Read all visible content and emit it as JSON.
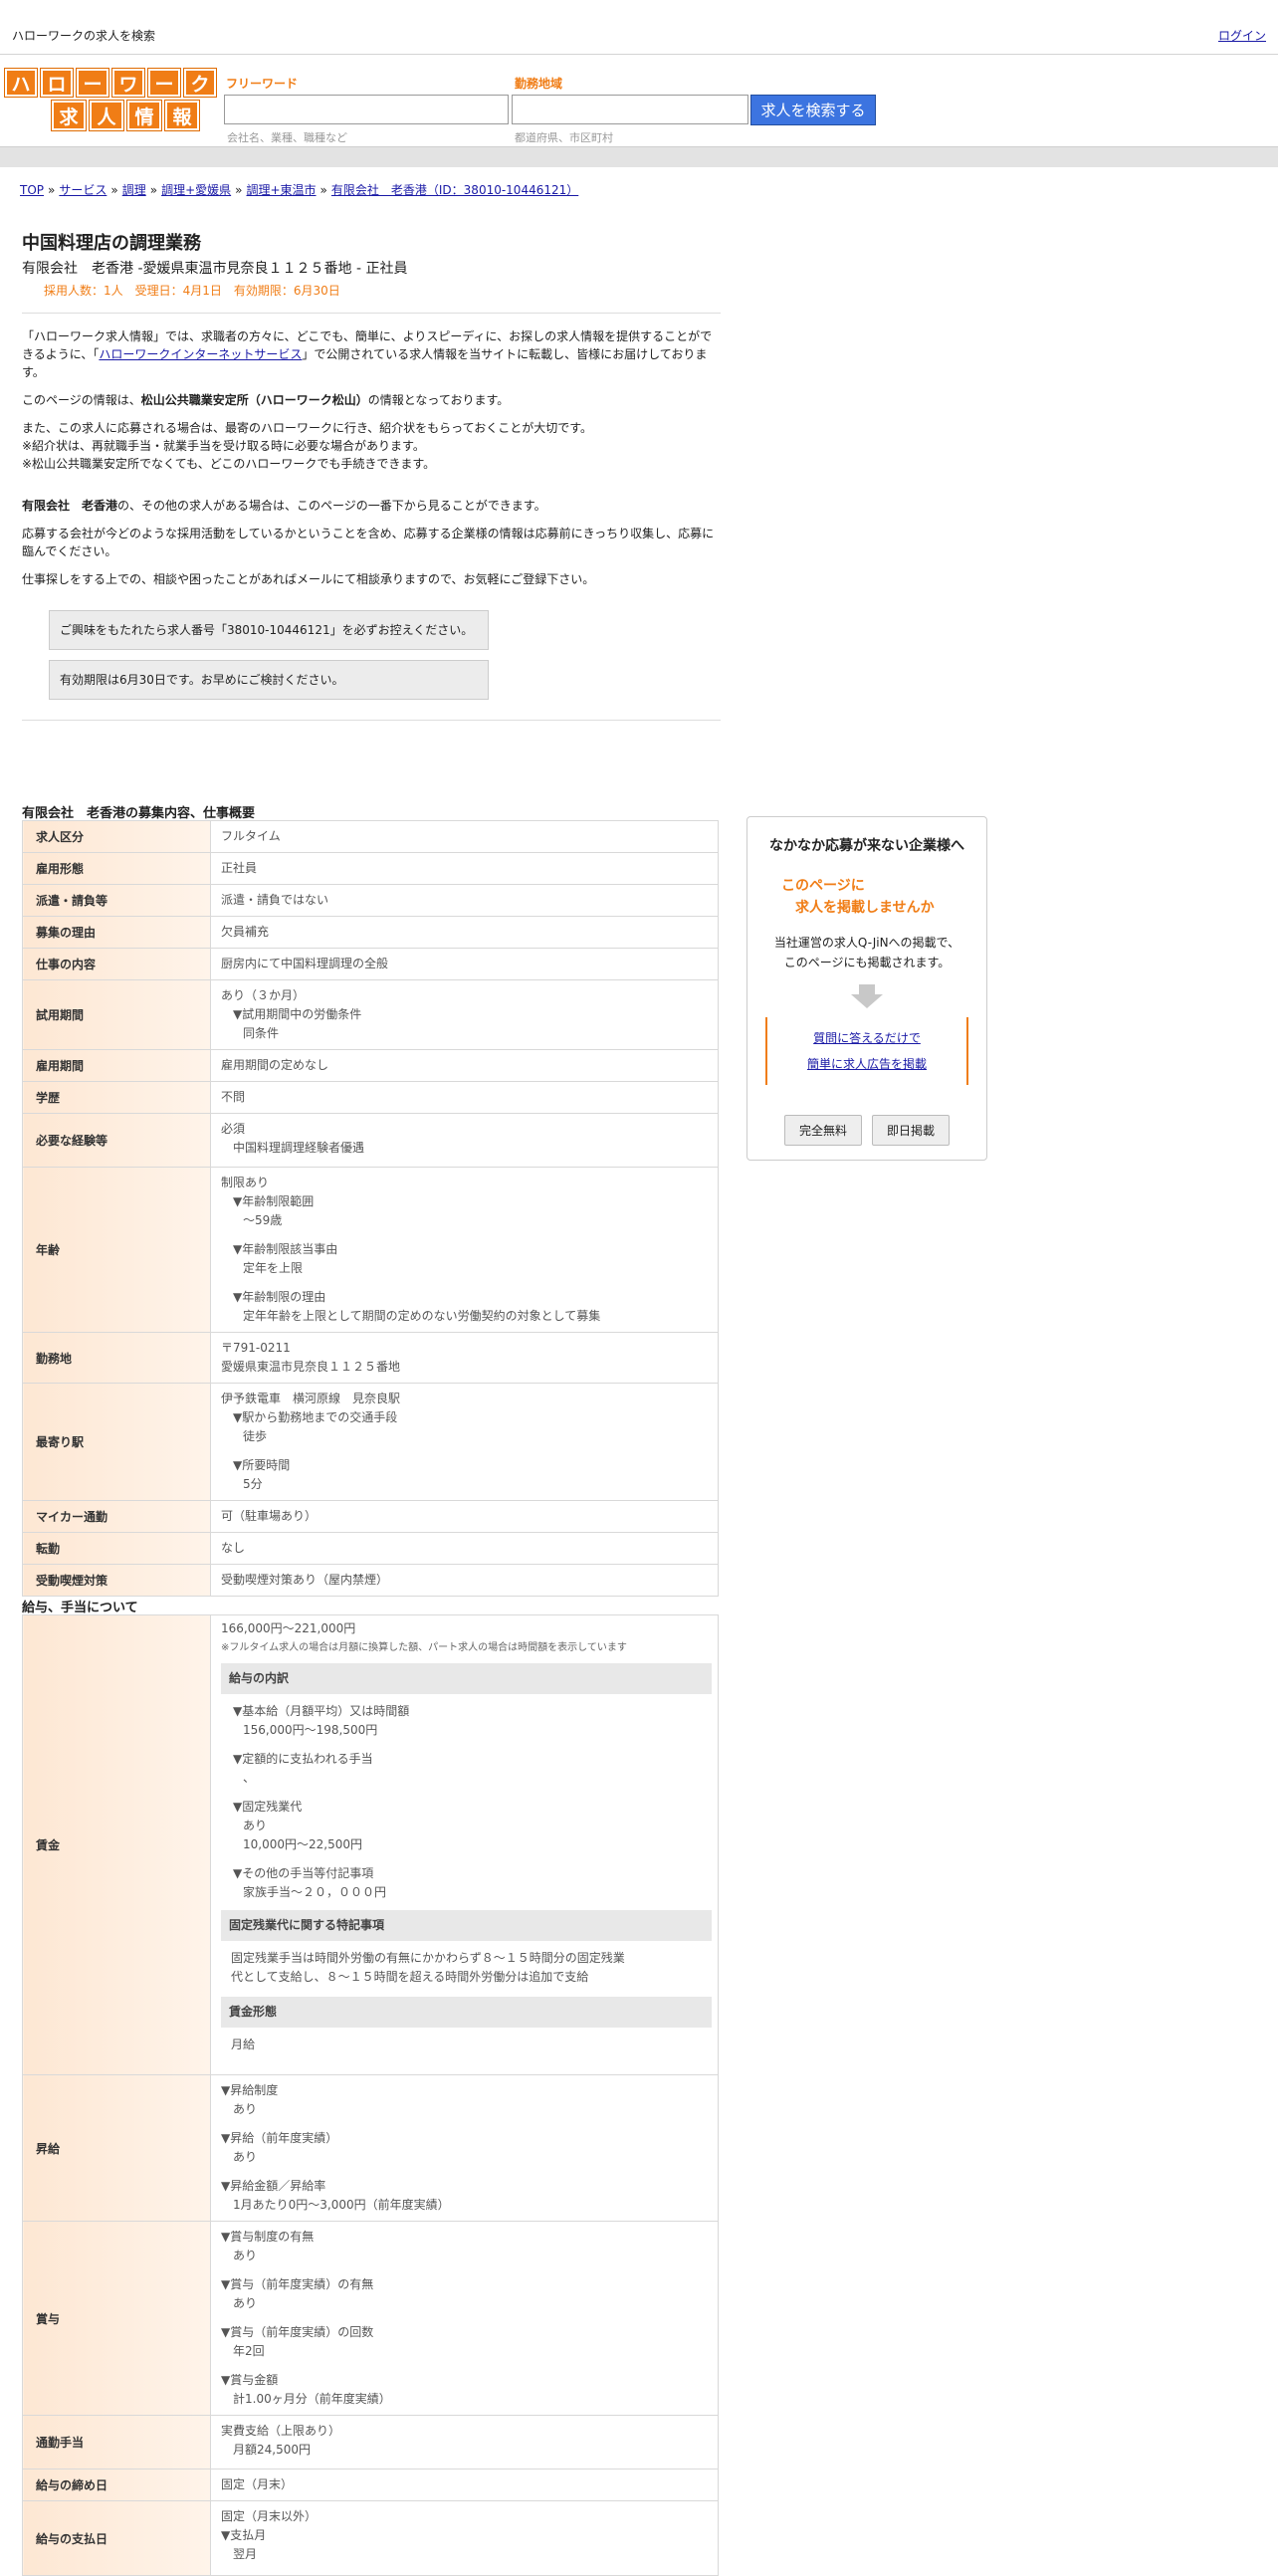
{
  "topbar": {
    "site_title": "ハローワークの求人を検索",
    "login": "ログイン"
  },
  "logo": {
    "row1": [
      "ハ",
      "ロ",
      "ー",
      "ワ",
      "ー",
      "ク"
    ],
    "row2": [
      "求",
      "人",
      "情",
      "報"
    ]
  },
  "search": {
    "keyword_label": "フリーワード",
    "keyword_placeholder": "会社名、業種、職種など",
    "area_label": "勤務地域",
    "area_placeholder": "都道府県、市区町村",
    "button": "求人を検索する"
  },
  "breadcrumb": [
    "TOP",
    "サービス",
    "調理",
    "調理+愛媛県",
    "調理+東温市",
    "有限会社　老香港（ID：38010-10446121）"
  ],
  "job": {
    "title": "中国料理店の調理業務",
    "subtitle": "有限会社　老香港 -愛媛県東温市見奈良１１２５番地 - 正社員",
    "meta": "採用人数：1人　受理日：4月1日　有効期限：6月30日"
  },
  "intro": {
    "p1_a": "「ハローワーク求人情報」では、求職者の方々に、どこでも、簡単に、よりスピーディに、お探しの求人情報を提供することができるように、「",
    "p1_link": "ハローワークインターネットサービス",
    "p1_b": "」で公開されている求人情報を当サイトに転載し、皆様にお届けしております。",
    "p2_a": "このページの情報は、",
    "p2_bold": "松山公共職業安定所（ハローワーク松山）",
    "p2_b": "の情報となっております。",
    "p3_1": "また、この求人に応募される場合は、最寄のハローワークに行き、紹介状をもらっておくことが大切です。",
    "p3_2": "※紹介状は、再就職手当・就業手当を受け取る時に必要な場合があります。",
    "p3_3": "※松山公共職業安定所でなくても、どこのハローワークでも手続きできます。",
    "p4_bold": "有限会社　老香港",
    "p4": "の、その他の求人がある場合は、このページの一番下から見ることができます。",
    "p5": "応募する会社が今どのような採用活動をしているかということを含め、応募する企業様の情報は応募前にきっちり収集し、応募に臨んでください。",
    "p6": "仕事探しをする上での、相談や困ったことがあればメールにて相談承りますので、お気軽にご登録下さい。"
  },
  "notes": {
    "n1": "ご興味をもたれたら求人番号「38010-10446121」を必ずお控えください。",
    "n2": "有効期限は6月30日です。お早めにご検討ください。"
  },
  "section1": {
    "heading": "有限会社　老香港の募集内容、仕事概要",
    "rows": {
      "kyujin_kubun": {
        "label": "求人区分",
        "value": "フルタイム"
      },
      "koyo_keitai": {
        "label": "雇用形態",
        "value": "正社員"
      },
      "haken": {
        "label": "派遣・請負等",
        "value": "派遣・請負ではない"
      },
      "riyu": {
        "label": "募集の理由",
        "value": "欠員補充"
      },
      "naiyo": {
        "label": "仕事の内容",
        "value": "厨房内にて中国料理調理の全般"
      },
      "shiyo": {
        "label": "試用期間",
        "l1": "あり（３か月）",
        "l2": "▼試用期間中の労働条件",
        "l3": "同条件"
      },
      "koyo_kikan": {
        "label": "雇用期間",
        "value": "雇用期間の定めなし"
      },
      "gakureki": {
        "label": "学歴",
        "value": "不問"
      },
      "keiken": {
        "label": "必要な経験等",
        "l1": "必須",
        "l2": "中国料理調理経験者優遇"
      },
      "nenrei": {
        "label": "年齢",
        "l1": "制限あり",
        "l2": "▼年齢制限範囲",
        "l3": "〜59歳",
        "l4": "▼年齢制限該当事由",
        "l5": "定年を上限",
        "l6": "▼年齢制限の理由",
        "l7": "定年年齢を上限として期間の定めのない労働契約の対象として募集"
      },
      "kinmuchi": {
        "label": "勤務地",
        "l1": "〒791-0211",
        "l2": "愛媛県東温市見奈良１１２５番地"
      },
      "eki": {
        "label": "最寄り駅",
        "l1": "伊予鉄電車　横河原線　見奈良駅",
        "l2": "▼駅から勤務地までの交通手段",
        "l3": "徒歩",
        "l4": "▼所要時間",
        "l5": "5分"
      },
      "mycar": {
        "label": "マイカー通勤",
        "value": "可（駐車場あり）"
      },
      "tenkin": {
        "label": "転勤",
        "value": "なし"
      },
      "kitsuen": {
        "label": "受動喫煙対策",
        "value": "受動喫煙対策あり（屋内禁煙）"
      }
    }
  },
  "section2": {
    "heading": "給与、手当について",
    "chingin": {
      "label": "賃金",
      "range": "166,000円〜221,000円",
      "note": "※フルタイム求人の場合は月額に換算した額、パート求人の場合は時間額を表示しています",
      "breakdown_head": "給与の内訳",
      "b1": "▼基本給（月額平均）又は時間額",
      "b1v": "156,000円〜198,500円",
      "b2": "▼定額的に支払われる手当",
      "b2v": "、",
      "b3": "▼固定残業代",
      "b3v1": "あり",
      "b3v2": "10,000円〜22,500円",
      "b4": "▼その他の手当等付記事項",
      "b4v": "家族手当～２０，０００円",
      "fixed_head": "固定残業代に関する特記事項",
      "fixed_text": "固定残業手当は時間外労働の有無にかかわらず８～１５時間分の固定残業代として支給し、８～１５時間を超える時間外労働分は追加で支給",
      "form_head": "賃金形態",
      "form_value": "月給"
    },
    "shokyu": {
      "label": "昇給",
      "l1": "▼昇給制度",
      "l1v": "あり",
      "l2": "▼昇給（前年度実績）",
      "l2v": "あり",
      "l3": "▼昇給金額／昇給率",
      "l3v": "1月あたり0円〜3,000円（前年度実績）"
    },
    "shoyo": {
      "label": "賞与",
      "l1": "▼賞与制度の有無",
      "l1v": "あり",
      "l2": "▼賞与（前年度実績）の有無",
      "l2v": "あり",
      "l3": "▼賞与（前年度実績）の回数",
      "l3v": "年2回",
      "l4": "▼賞与金額",
      "l4v": "計1.00ヶ月分（前年度実績）"
    },
    "tsukin": {
      "label": "通勤手当",
      "l1": "実費支給（上限あり）",
      "l2": "月額24,500円"
    },
    "shimebi": {
      "label": "給与の締め日",
      "value": "固定（月末）"
    },
    "shiharai": {
      "label": "給与の支払日",
      "l1": "固定（月末以外）",
      "l2": "▼支払月",
      "l3": "翌月"
    }
  },
  "sidebar": {
    "heading": "なかなか応募が来ない企業様へ",
    "catch1": "このページに",
    "catch2": "求人を掲載しませんか",
    "desc1": "当社運営の求人Q-JiNへの掲載で、",
    "desc2": "このページにも掲載されます。",
    "link1": "質問に答えるだけで",
    "link2": "簡単に求人広告を掲載",
    "btn1": "完全無料",
    "btn2": "即日掲載"
  }
}
